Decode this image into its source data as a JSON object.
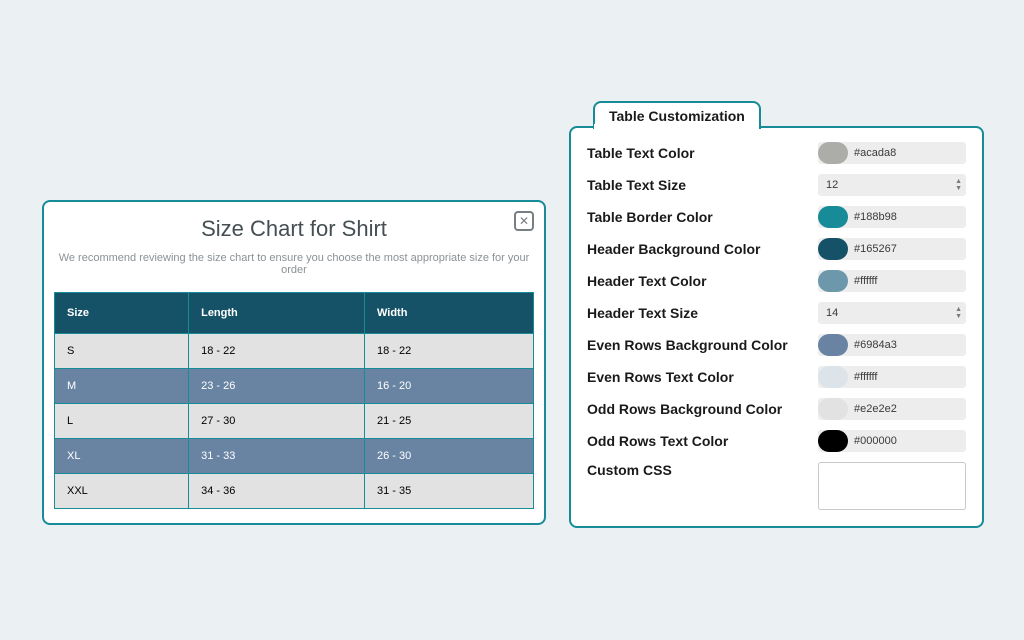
{
  "modal": {
    "title": "Size Chart for Shirt",
    "subtitle": "We recommend reviewing the size chart to ensure you choose the most appropriate size for your order",
    "columns": [
      "Size",
      "Length",
      "Width"
    ],
    "rows": [
      {
        "size": "S",
        "length": "18 - 22",
        "width": "18 - 22"
      },
      {
        "size": "M",
        "length": "23 - 26",
        "width": "16 - 20"
      },
      {
        "size": "L",
        "length": "27 - 30",
        "width": "21 - 25"
      },
      {
        "size": "XL",
        "length": "31 - 33",
        "width": "26 - 30"
      },
      {
        "size": "XXL",
        "length": "34 - 36",
        "width": "31 - 35"
      }
    ]
  },
  "panel": {
    "tab_label": "Table Customization",
    "fields": {
      "table_text_color": {
        "label": "Table Text Color",
        "value": "#acada8",
        "swatch": "#acada8"
      },
      "table_text_size": {
        "label": "Table Text Size",
        "value": "12"
      },
      "table_border_color": {
        "label": "Table Border Color",
        "value": "#188b98",
        "swatch": "#188b98"
      },
      "header_bg_color": {
        "label": "Header Background Color",
        "value": "#165267",
        "swatch": "#165267"
      },
      "header_text_color": {
        "label": "Header Text Color",
        "value": "#ffffff",
        "swatch": "#6d97ab"
      },
      "header_text_size": {
        "label": "Header Text Size",
        "value": "14"
      },
      "even_bg_color": {
        "label": "Even Rows Background Color",
        "value": "#6984a3",
        "swatch": "#6984a3"
      },
      "even_text_color": {
        "label": "Even Rows Text Color",
        "value": "#ffffff",
        "swatch": "#dde4e9"
      },
      "odd_bg_color": {
        "label": "Odd Rows Background Color",
        "value": "#e2e2e2",
        "swatch": "#e2e2e2"
      },
      "odd_text_color": {
        "label": "Odd Rows Text Color",
        "value": "#000000",
        "swatch": "#000000"
      },
      "custom_css": {
        "label": "Custom CSS"
      }
    }
  }
}
